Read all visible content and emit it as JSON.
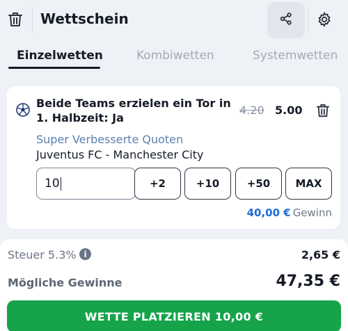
{
  "header": {
    "title": "Wettschein",
    "icons": [
      "trash-icon",
      "share-icon",
      "gear-icon"
    ]
  },
  "tabs": [
    {
      "label": "Einzelwetten",
      "active": true
    },
    {
      "label": "Kombiwetten",
      "active": false
    },
    {
      "label": "Systemwetten",
      "active": false
    }
  ],
  "bet": {
    "selection": "Beide Teams erzielen ein Tor in 1. Halbzeit: Ja",
    "old_odds": "4.20",
    "new_odds": "5.00",
    "boost_label": "Super Verbesserte Quoten",
    "match": "Juventus FC - Manchester City",
    "stake_value": "10",
    "quick_stakes": [
      "+2",
      "+10",
      "+50",
      "MAX"
    ],
    "win_amount": "40,00 €",
    "win_label": "Gewinn"
  },
  "summary": {
    "tax_label": "Steuer 5.3%",
    "tax_value": "2,65 €",
    "possible_win_label": "Mögliche Gewinne",
    "possible_win_value": "47,35 €",
    "place_button": "WETTE PLATZIEREN 10,00 €"
  },
  "colors": {
    "accent_green": "#16a34a",
    "link_blue": "#1f6dd1",
    "boost_blue": "#5b7fae"
  }
}
